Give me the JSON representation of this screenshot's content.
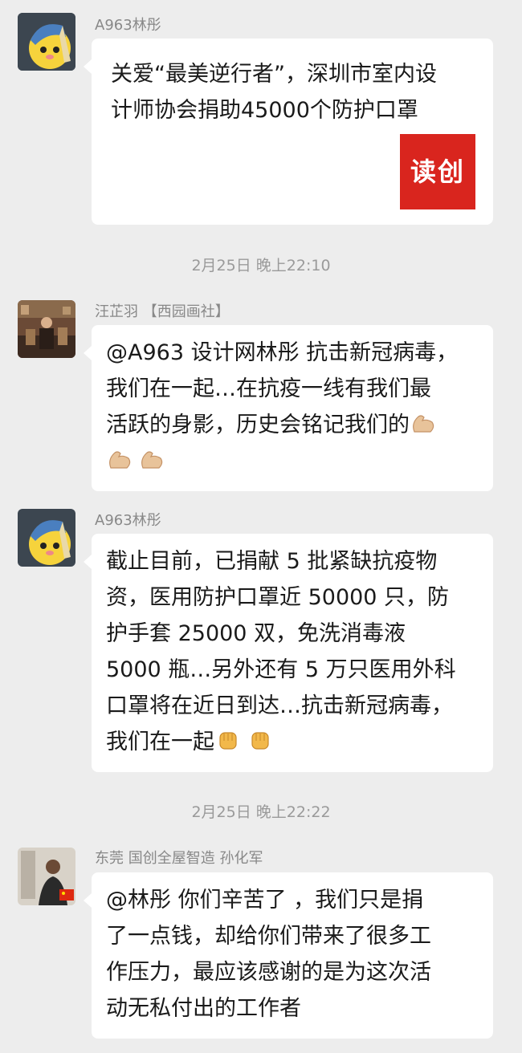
{
  "messages": [
    {
      "sender": "A963林彤",
      "lines": [
        "关爱“最美逆行者”，深圳市室内设",
        "计师协会捐助45000个防护口罩"
      ],
      "logo_text": "读创"
    },
    {
      "sender": "汪芷羽 【西园画社】",
      "lines": [
        "@A963 设计网林彤  抗击新冠病毒，",
        "我们在一起…在抗疫一线有我们最",
        "活跃的身影，历史会铭记我们的"
      ],
      "emoji": [
        "flexed-biceps",
        "flexed-biceps",
        "flexed-biceps"
      ]
    },
    {
      "sender": "A963林彤",
      "lines": [
        "截止目前，已捐献 5 批紧缺抗疫物",
        "资，医用防护口罩近 50000 只，防",
        "护手套 25000 双，免洗消毒液",
        "5000 瓶…另外还有 5 万只医用外科",
        "口罩将在近日到达…抗击新冠病毒，",
        "我们在一起"
      ],
      "emoji": [
        "raised-fist",
        "raised-fist"
      ]
    },
    {
      "sender": "东莞 国创全屋智造  孙化军",
      "lines": [
        "@林彤  你们辛苦了 ，我们只是捐",
        "了一点钱，却给你们带来了很多工",
        "作压力，最应该感谢的是为这次活",
        "动无私付出的工作者"
      ]
    }
  ],
  "timestamps": [
    "2月25日 晚上22:10",
    "2月25日 晚上22:22"
  ]
}
